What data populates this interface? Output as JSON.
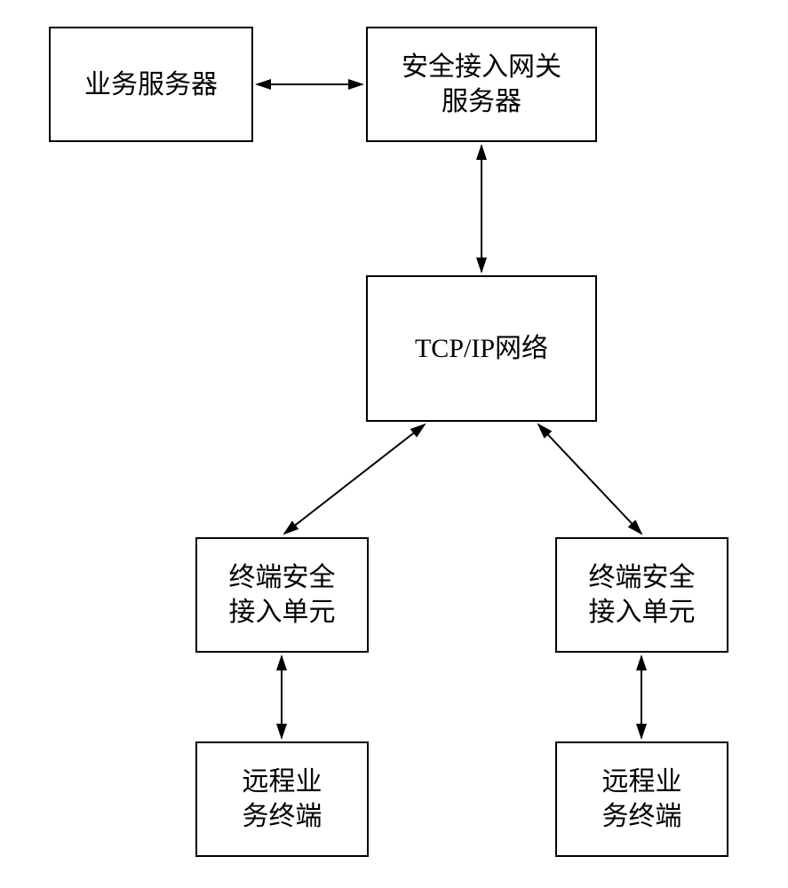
{
  "diagram": {
    "nodes": {
      "business_server": "业务服务器",
      "gateway_server": "安全接入网关\n服务器",
      "tcp_ip": "TCP/IP网络",
      "terminal_unit_left": "终端安全\n接入单元",
      "terminal_unit_right": "终端安全\n接入单元",
      "remote_terminal_left": "远程业\n务终端",
      "remote_terminal_right": "远程业\n务终端"
    }
  }
}
